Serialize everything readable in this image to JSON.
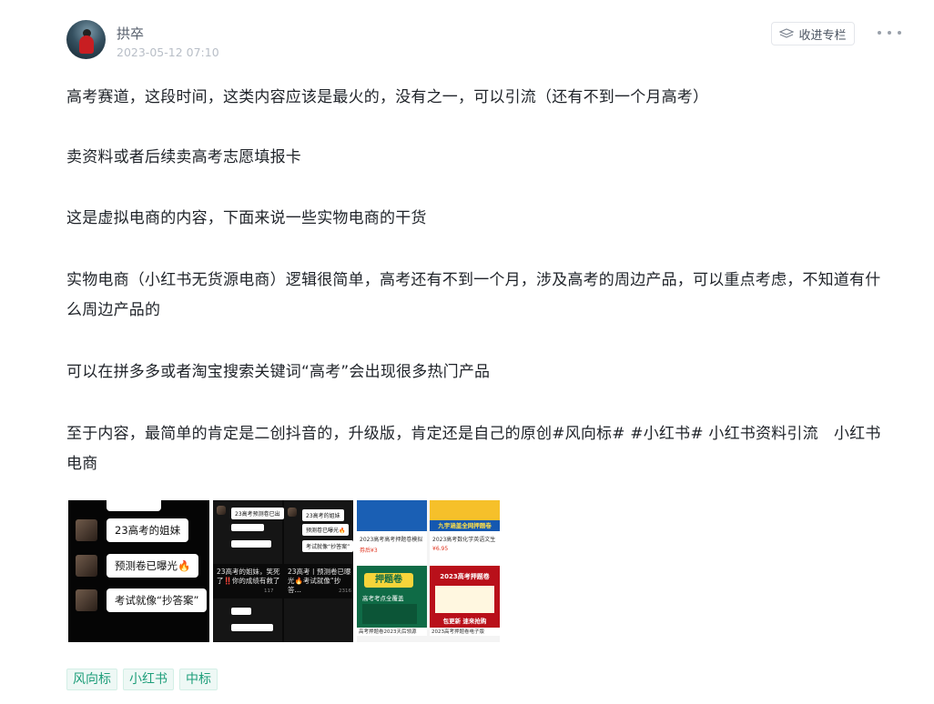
{
  "header": {
    "author": "拱卒",
    "timestamp": "2023-05-12 07:10",
    "collect_label": "收进专栏",
    "collect_icon": "collect-icon",
    "more_icon": "more-icon"
  },
  "paragraphs": [
    "高考赛道，这段时间，这类内容应该是最火的，没有之一，可以引流（还有不到一个月高考）",
    "卖资料或者后续卖高考志愿填报卡",
    "这是虚拟电商的内容，下面来说一些实物电商的干货",
    "实物电商（小红书无货源电商）逻辑很简单，高考还有不到一个月，涉及高考的周边产品，可以重点考虑，不知道有什么周边产品的",
    "可以在拼多多或者淘宝搜索关键词“高考”会出现很多热门产品",
    "至于内容，最简单的肯定是二创抖音的，升级版，肯定还是自己的原创#风向标# #小红书# 小红书资料引流　小红书电商"
  ],
  "images": {
    "img1": {
      "bubbles": [
        "23高考的姐妹",
        "预测卷已曝光🔥",
        "考试就像“抄答案”"
      ]
    },
    "img2": {
      "caption_left": "23高考的姐妹，笑死了‼️你的成绩有救了",
      "caption_right": "23高考丨预测卷已曝光🔥考试就像“抄答…",
      "bubble_a": "23高考预测卷已出",
      "bubble_b": "23高考的姐妹",
      "bubble_c": "预测卷已曝光🔥",
      "bubble_d": "考试就像“抄答案”",
      "likes_left": "117",
      "likes_right": "2316"
    },
    "img3": {
      "t1_caption": "2023高考高考押题卷模拟",
      "t1_price": "券后¥3",
      "t2_banner": "九宇涵盖全网押题卷",
      "t2_caption": "2023高考数化学英语文生",
      "t2_price": "¥6.95",
      "t3_title": "押题卷",
      "t3_sub": "高考考点全覆盖",
      "t3_caption": "高考押题卷2023天后领源",
      "t4_title": "2023高考押题卷",
      "t4_sub": "包更新 速来抢购",
      "t4_caption": "2023高考押题卷电子版"
    }
  },
  "tags": [
    "风向标",
    "小红书",
    "中标"
  ]
}
